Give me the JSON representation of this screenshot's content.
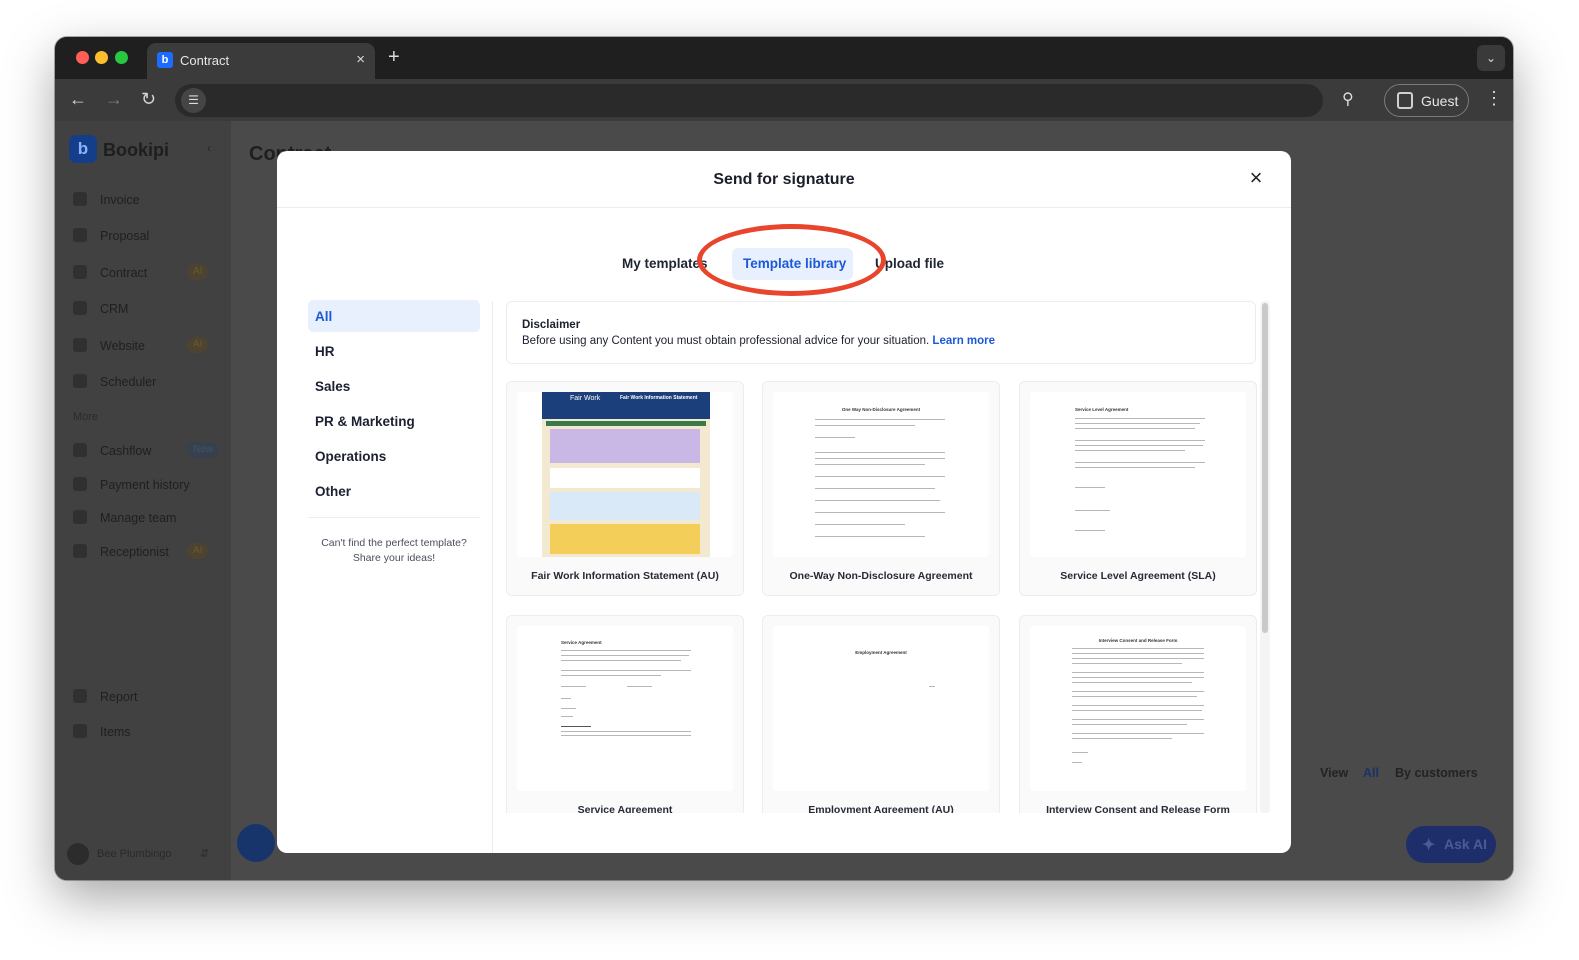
{
  "browser": {
    "tab_title": "Contract",
    "tab_close": "×",
    "new_tab": "+",
    "guest_label": "Guest"
  },
  "sidebar": {
    "brand": "Bookipi",
    "items": [
      {
        "label": "Invoice",
        "badge": ""
      },
      {
        "label": "Proposal",
        "badge": ""
      },
      {
        "label": "Contract",
        "badge": "AI"
      },
      {
        "label": "CRM",
        "badge": ""
      },
      {
        "label": "Website",
        "badge": "AI"
      },
      {
        "label": "Scheduler",
        "badge": ""
      }
    ],
    "more_label": "More",
    "more_items": [
      {
        "label": "Cashflow",
        "badge": "New"
      },
      {
        "label": "Payment history",
        "badge": ""
      },
      {
        "label": "Manage team",
        "badge": ""
      },
      {
        "label": "Receptionist",
        "badge": "AI"
      }
    ],
    "bottom_items": [
      {
        "label": "Report"
      },
      {
        "label": "Items"
      }
    ],
    "user_name": "Bee Plumbingo"
  },
  "background": {
    "page_title": "Contract",
    "view_label": "View",
    "view_all": "All",
    "view_by_customers": "By customers",
    "ask_ai": "Ask AI"
  },
  "modal": {
    "title": "Send for signature",
    "close": "×",
    "tabs": [
      {
        "label": "My templates"
      },
      {
        "label": "Template library",
        "active": true
      },
      {
        "label": "Upload file"
      }
    ],
    "categories": [
      {
        "label": "All",
        "active": true
      },
      {
        "label": "HR"
      },
      {
        "label": "Sales"
      },
      {
        "label": "PR & Marketing"
      },
      {
        "label": "Operations"
      },
      {
        "label": "Other"
      }
    ],
    "cant_find_line1": "Can't find the perfect template?",
    "cant_find_line2": "Share your ideas!",
    "disclaimer_title": "Disclaimer",
    "disclaimer_body": "Before using any Content you must obtain professional advice for your situation.",
    "disclaimer_link": "Learn more",
    "templates": [
      {
        "label": "Fair Work Information Statement (AU)",
        "thumb_title": "Fair Work Information Statement",
        "thumb_logo": "Fair Work"
      },
      {
        "label": "One-Way Non-Disclosure Agreement",
        "thumb_title": "One Way Non-Disclosure Agreement"
      },
      {
        "label": "Service Level Agreement (SLA)",
        "thumb_title": "Service Level Agreement"
      },
      {
        "label": "Service Agreement",
        "thumb_title": "Service Agreement"
      },
      {
        "label": "Employment Agreement (AU)",
        "thumb_title": "Employment Agreement"
      },
      {
        "label": "Interview Consent and Release Form",
        "thumb_title": "Interview Consent and Release Form"
      }
    ]
  },
  "colors": {
    "accent": "#1c58d8",
    "active_bg": "#e8f0fe",
    "highlight_ring": "#e8452c"
  }
}
